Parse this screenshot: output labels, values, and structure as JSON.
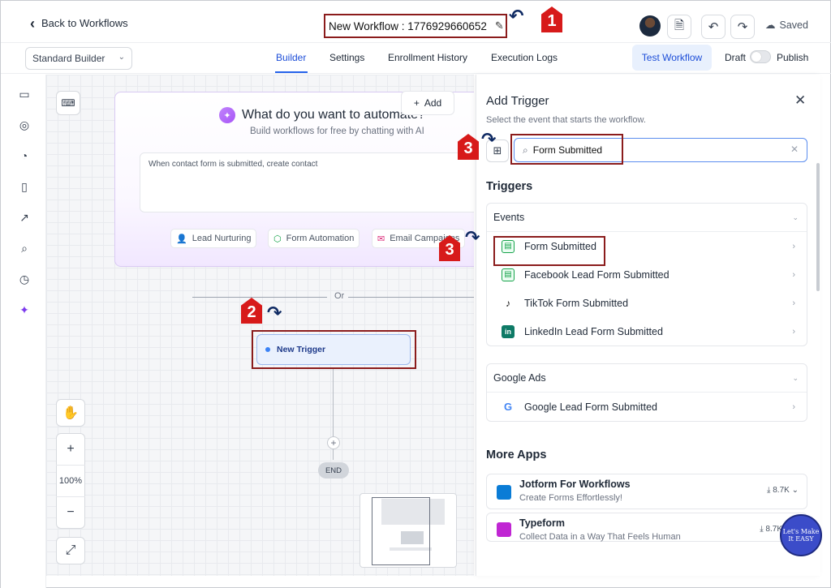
{
  "header": {
    "back_label": "Back to Workflows",
    "workflow_title": "New Workflow : 1776929660652",
    "saved_label": "Saved"
  },
  "subbar": {
    "builder_select": "Standard Builder",
    "tabs": [
      {
        "label": "Builder",
        "active": true
      },
      {
        "label": "Settings",
        "active": false
      },
      {
        "label": "Enrollment History",
        "active": false
      },
      {
        "label": "Execution Logs",
        "active": false
      }
    ],
    "test_workflow": "Test Workflow",
    "draft": "Draft",
    "publish": "Publish"
  },
  "canvas": {
    "ai_title": "What do you want to automate?",
    "ai_subtitle": "Build workflows for free by chatting with AI",
    "ai_input_text": "When contact form is submitted, create contact",
    "chips": [
      "Lead Nurturing",
      "Form Automation",
      "Email Campaigns"
    ],
    "add_label": "Add",
    "or_label": "Or",
    "trigger_label": "New Trigger",
    "end_label": "END",
    "zoom_level": "100%",
    "zoom_in": "+",
    "zoom_out": "−"
  },
  "panel": {
    "title": "Add Trigger",
    "subtitle": "Select the event that starts the workflow.",
    "search_value": "Form Submitted",
    "triggers_heading": "Triggers",
    "events_group": {
      "label": "Events",
      "items": [
        {
          "label": "Form Submitted",
          "icon": "form-icon"
        },
        {
          "label": "Facebook Lead Form Submitted",
          "icon": "form-icon"
        },
        {
          "label": "TikTok Form Submitted",
          "icon": "tiktok-icon"
        },
        {
          "label": "LinkedIn Lead Form Submitted",
          "icon": "linkedin-icon"
        }
      ]
    },
    "google_group": {
      "label": "Google Ads",
      "items": [
        {
          "label": "Google Lead Form Submitted",
          "icon": "google-icon"
        }
      ]
    },
    "more_apps_heading": "More Apps",
    "apps": [
      {
        "name": "Jotform For Workflows",
        "desc": "Create Forms Effortlessly!",
        "count": "8.7K",
        "color": "#0a7cd6"
      },
      {
        "name": "Typeform",
        "desc": "Collect Data in a Way That Feels Human",
        "count": "8.7K",
        "color": "#c026d3"
      }
    ]
  },
  "annotations": {
    "marker_1": "1",
    "marker_2": "2",
    "marker_3a": "3",
    "marker_3b": "3"
  },
  "watermark": "Let's Make It EASY",
  "colors": {
    "accent": "#2563eb",
    "annotation_red": "#d71a1a",
    "outline_red": "#8b1c1c"
  }
}
